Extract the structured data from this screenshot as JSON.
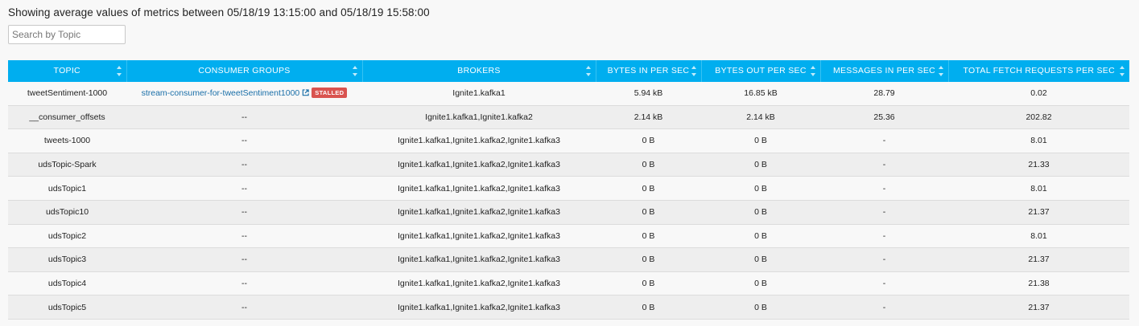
{
  "summary_text": "Showing average values of metrics between 05/18/19 13:15:00 and 05/18/19 15:58:00",
  "search": {
    "placeholder": "Search by Topic",
    "value": ""
  },
  "table": {
    "headers": {
      "topic": "TOPIC",
      "consumer_groups": "CONSUMER GROUPS",
      "brokers": "BROKERS",
      "bytes_in": "BYTES IN PER SEC",
      "bytes_out": "BYTES OUT PER SEC",
      "messages_in": "MESSAGES IN PER SEC",
      "fetch_requests": "TOTAL FETCH REQUESTS PER SEC"
    },
    "rows": [
      {
        "topic": "tweetSentiment-1000",
        "consumer_group": "stream-consumer-for-tweetSentiment1000",
        "status": "STALLED",
        "brokers": "Ignite1.kafka1",
        "bytes_in": "5.94 kB",
        "bytes_out": "16.85 kB",
        "messages_in": "28.79",
        "fetch_requests": "0.02"
      },
      {
        "topic": "__consumer_offsets",
        "consumer_group": "--",
        "status": "",
        "brokers": "Ignite1.kafka1,Ignite1.kafka2",
        "bytes_in": "2.14 kB",
        "bytes_out": "2.14 kB",
        "messages_in": "25.36",
        "fetch_requests": "202.82"
      },
      {
        "topic": "tweets-1000",
        "consumer_group": "--",
        "status": "",
        "brokers": "Ignite1.kafka1,Ignite1.kafka2,Ignite1.kafka3",
        "bytes_in": "0 B",
        "bytes_out": "0 B",
        "messages_in": "-",
        "fetch_requests": "8.01"
      },
      {
        "topic": "udsTopic-Spark",
        "consumer_group": "--",
        "status": "",
        "brokers": "Ignite1.kafka1,Ignite1.kafka2,Ignite1.kafka3",
        "bytes_in": "0 B",
        "bytes_out": "0 B",
        "messages_in": "-",
        "fetch_requests": "21.33"
      },
      {
        "topic": "udsTopic1",
        "consumer_group": "--",
        "status": "",
        "brokers": "Ignite1.kafka1,Ignite1.kafka2,Ignite1.kafka3",
        "bytes_in": "0 B",
        "bytes_out": "0 B",
        "messages_in": "-",
        "fetch_requests": "8.01"
      },
      {
        "topic": "udsTopic10",
        "consumer_group": "--",
        "status": "",
        "brokers": "Ignite1.kafka1,Ignite1.kafka2,Ignite1.kafka3",
        "bytes_in": "0 B",
        "bytes_out": "0 B",
        "messages_in": "-",
        "fetch_requests": "21.37"
      },
      {
        "topic": "udsTopic2",
        "consumer_group": "--",
        "status": "",
        "brokers": "Ignite1.kafka1,Ignite1.kafka2,Ignite1.kafka3",
        "bytes_in": "0 B",
        "bytes_out": "0 B",
        "messages_in": "-",
        "fetch_requests": "8.01"
      },
      {
        "topic": "udsTopic3",
        "consumer_group": "--",
        "status": "",
        "brokers": "Ignite1.kafka1,Ignite1.kafka2,Ignite1.kafka3",
        "bytes_in": "0 B",
        "bytes_out": "0 B",
        "messages_in": "-",
        "fetch_requests": "21.37"
      },
      {
        "topic": "udsTopic4",
        "consumer_group": "--",
        "status": "",
        "brokers": "Ignite1.kafka1,Ignite1.kafka2,Ignite1.kafka3",
        "bytes_in": "0 B",
        "bytes_out": "0 B",
        "messages_in": "-",
        "fetch_requests": "21.38"
      },
      {
        "topic": "udsTopic5",
        "consumer_group": "--",
        "status": "",
        "brokers": "Ignite1.kafka1,Ignite1.kafka2,Ignite1.kafka3",
        "bytes_in": "0 B",
        "bytes_out": "0 B",
        "messages_in": "-",
        "fetch_requests": "21.37"
      }
    ]
  },
  "icons": {
    "external_link": "external-link-icon",
    "sort": "sort-arrows-icon"
  },
  "colors": {
    "header_bg": "#00aeef",
    "link": "#1a6fa8",
    "stalled_badge": "#d9534f"
  }
}
